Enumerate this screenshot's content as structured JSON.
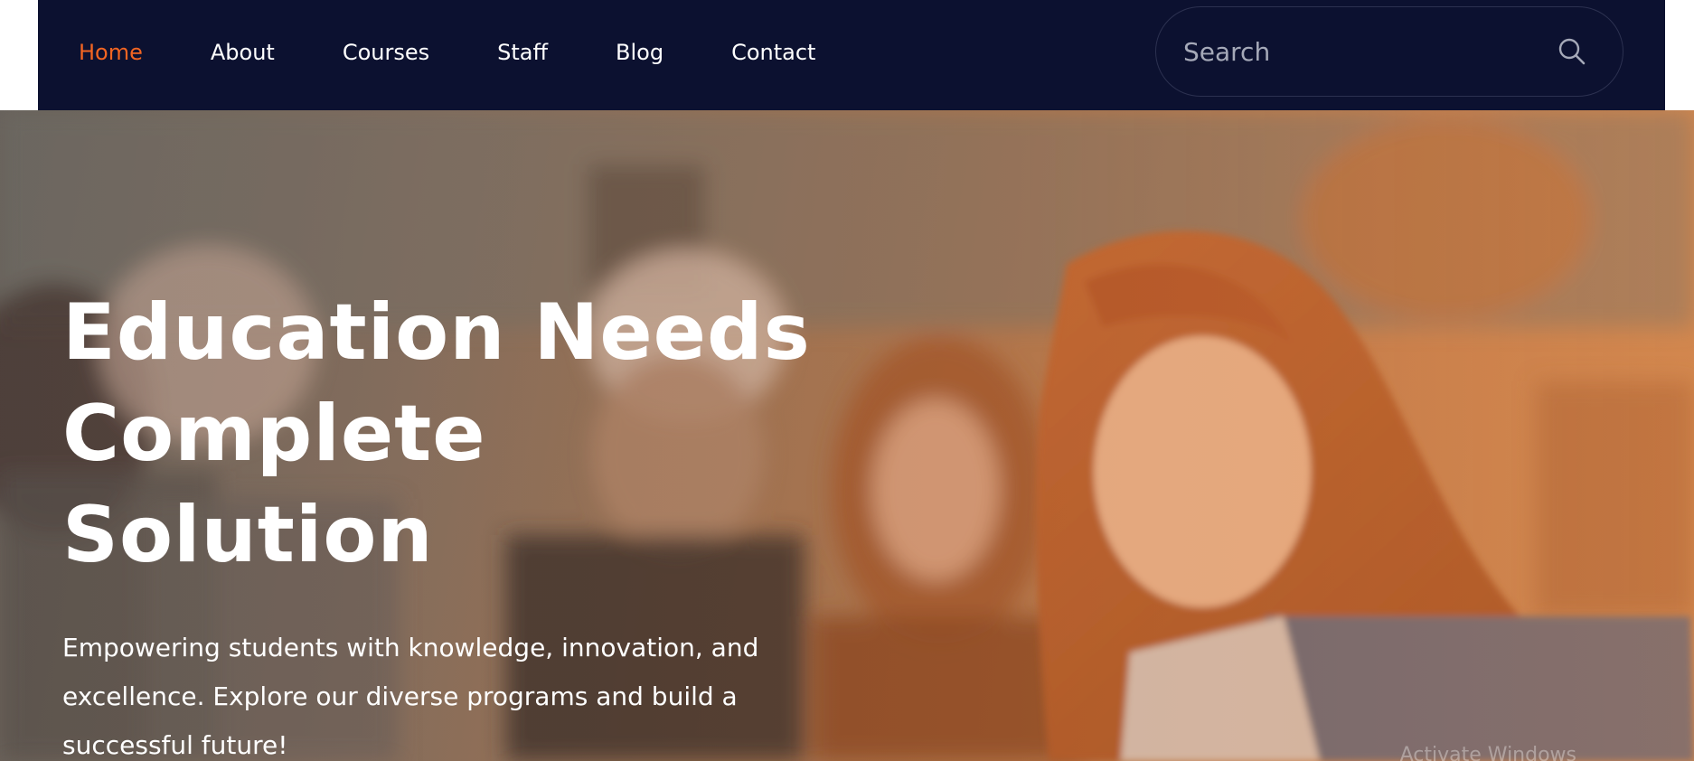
{
  "nav": {
    "items": [
      {
        "label": "Home",
        "active": true
      },
      {
        "label": "About",
        "active": false
      },
      {
        "label": "Courses",
        "active": false
      },
      {
        "label": "Staff",
        "active": false
      },
      {
        "label": "Blog",
        "active": false
      },
      {
        "label": "Contact",
        "active": false
      }
    ],
    "search": {
      "placeholder": "Search",
      "value": "",
      "icon": "search-icon"
    }
  },
  "hero": {
    "title": "Education Needs Complete Solution",
    "subtitle": "Empowering students with knowledge, innovation, and excellence. Explore our diverse programs and build a successful future!"
  },
  "system": {
    "watermark": "Activate Windows"
  },
  "colors": {
    "nav_background": "#0c1130",
    "accent": "#f26522",
    "hero_tint": "#cc8452"
  }
}
